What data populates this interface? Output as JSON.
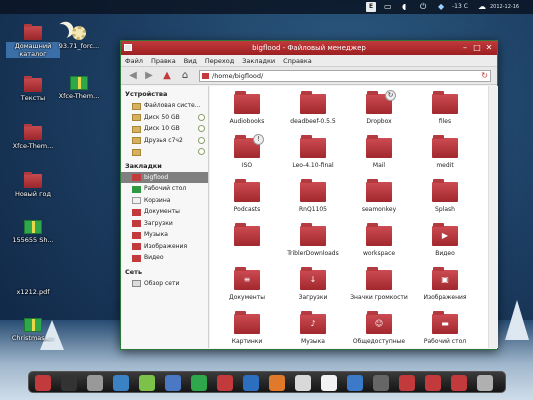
{
  "top_panel": {
    "badge_e": "E",
    "weather": "-13 C",
    "clock": "2012-12-16"
  },
  "desktop_icons": [
    {
      "label": "Домашний каталог",
      "icon": "home-folder-icon",
      "selected": true
    },
    {
      "label": "93.71_forc...",
      "icon": "gear-icon"
    },
    {
      "label": "Тексты",
      "icon": "red-folder-icon"
    },
    {
      "label": "Xfce-Them...",
      "icon": "gift-icon"
    },
    {
      "label": "Xfce-Them...",
      "icon": "red-folder-icon"
    },
    {
      "label": "Новый год",
      "icon": "red-folder-icon"
    },
    {
      "label": "155655 Sh...",
      "icon": "gift-icon"
    },
    {
      "label": "x1212.pdf",
      "icon": "pdf-icon"
    },
    {
      "label": "Christmas_...",
      "icon": "gift-icon"
    }
  ],
  "window": {
    "title": "bigflood - Файловый менеджер",
    "menu": [
      "Файл",
      "Правка",
      "Вид",
      "Переход",
      "Закладки",
      "Справка"
    ],
    "path": "/home/bigflood/",
    "sidebar": {
      "devices_heading": "Устройства",
      "devices": [
        {
          "label": "Файловая систе...",
          "icon": "drive-icon",
          "eject": false
        },
        {
          "label": "Диск 50 GB",
          "icon": "drive-icon",
          "eject": true
        },
        {
          "label": "Диск 10 GB",
          "icon": "drive-icon",
          "eject": true
        },
        {
          "label": "Друзья с7ч2",
          "icon": "drive-icon",
          "eject": true
        },
        {
          "label": "",
          "icon": "drive-icon",
          "eject": true
        }
      ],
      "bookmarks_heading": "Закладки",
      "bookmarks": [
        {
          "label": "bigflood",
          "icon": "home-folder-icon",
          "active": true
        },
        {
          "label": "Рабочий стол",
          "icon": "desktop-folder-icon"
        },
        {
          "label": "Корзина",
          "icon": "trash-icon"
        },
        {
          "label": "Документы",
          "icon": "folder-icon"
        },
        {
          "label": "Загрузки",
          "icon": "folder-icon"
        },
        {
          "label": "Музыка",
          "icon": "folder-icon"
        },
        {
          "label": "Изображения",
          "icon": "folder-icon"
        },
        {
          "label": "Видео",
          "icon": "folder-icon"
        }
      ],
      "network_heading": "Сеть",
      "network": [
        {
          "label": "Обзор сети",
          "icon": "network-icon"
        }
      ]
    },
    "files": [
      {
        "name": "Audiobooks",
        "emblem": ""
      },
      {
        "name": "deadbeef-0.5.5",
        "emblem": ""
      },
      {
        "name": "Dropbox",
        "emblem": "sync"
      },
      {
        "name": "files",
        "emblem": ""
      },
      {
        "name": "ISO",
        "emblem": "info"
      },
      {
        "name": "Leo-4.10-final",
        "emblem": ""
      },
      {
        "name": "Mail",
        "emblem": ""
      },
      {
        "name": "medit",
        "emblem": ""
      },
      {
        "name": "Podcasts",
        "emblem": ""
      },
      {
        "name": "RnQ1105",
        "emblem": ""
      },
      {
        "name": "seamonkey",
        "emblem": ""
      },
      {
        "name": "Splash",
        "emblem": ""
      },
      {
        "name": "",
        "emblem": ""
      },
      {
        "name": "TriblerDownloads",
        "emblem": ""
      },
      {
        "name": "workspace",
        "emblem": ""
      },
      {
        "name": "Видео",
        "emblem": "video"
      },
      {
        "name": "Документы",
        "emblem": "doc"
      },
      {
        "name": "Загрузки",
        "emblem": "download"
      },
      {
        "name": "Значки громкости",
        "emblem": ""
      },
      {
        "name": "Изображения",
        "emblem": "image"
      },
      {
        "name": "Картинки",
        "emblem": ""
      },
      {
        "name": "Музыка",
        "emblem": "music"
      },
      {
        "name": "Общедоступные",
        "emblem": "public"
      },
      {
        "name": "Рабочий стол",
        "emblem": "desktop"
      }
    ]
  },
  "dock_icons": [
    "santa-icon",
    "terminal-icon",
    "calculator-icon",
    "browser-icon",
    "chart-icon",
    "document-icon",
    "gift-icon",
    "santa-icon",
    "globe-icon",
    "firefox-icon",
    "mail-icon",
    "snowman-icon",
    "settings-icon",
    "camera-icon",
    "folder-icon",
    "folder-icon",
    "folder-icon",
    "trash-icon"
  ],
  "colors": {
    "accent": "#c23a3c",
    "selection": "#7f7f7f"
  }
}
